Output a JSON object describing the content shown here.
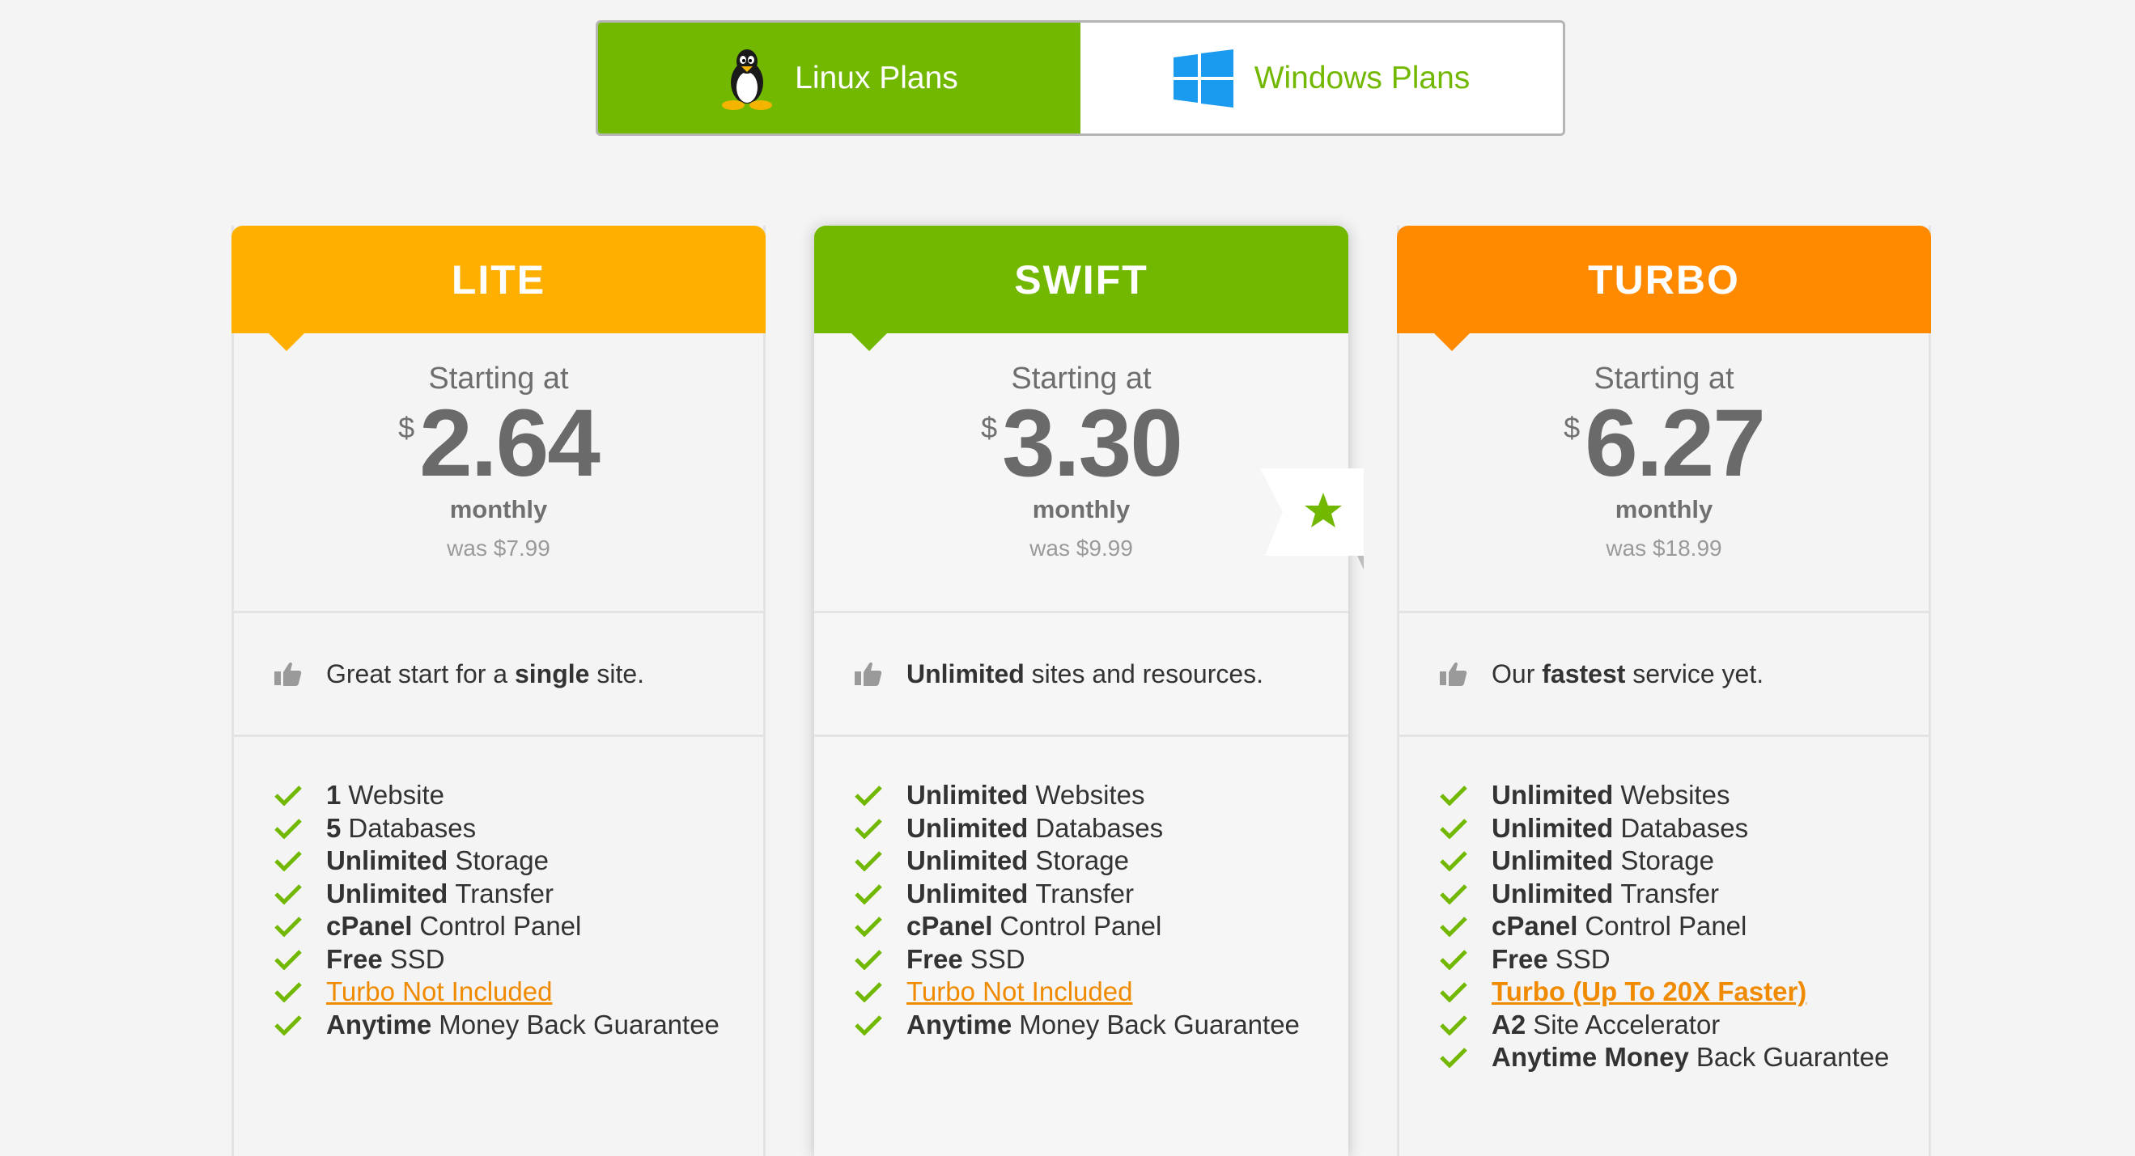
{
  "os_tabs": [
    {
      "label": "Linux Plans",
      "icon": "penguin-icon",
      "active": true
    },
    {
      "label": "Windows Plans",
      "icon": "windows-logo-icon",
      "active": false
    }
  ],
  "colors": {
    "lite": "#ffaf00",
    "swift": "#72b800",
    "turbo": "#ff8a00",
    "link": "#f08a00",
    "check": "#72b800"
  },
  "plans": [
    {
      "name": "LITE",
      "starting": "Starting at",
      "currency": "$",
      "price": "2.64",
      "period": "monthly",
      "was": "was $7.99",
      "tag_pre": "Great start for a",
      "tag_bold": "single",
      "tag_post": "site.",
      "features": [
        {
          "bold": "1",
          "text": "Website"
        },
        {
          "bold": "5",
          "text": "Databases"
        },
        {
          "bold": "Unlimited",
          "text": "Storage"
        },
        {
          "bold": "Unlimited",
          "text": "Transfer"
        },
        {
          "bold": "cPanel",
          "text": "Control Panel"
        },
        {
          "bold": "Free",
          "text": "SSD"
        },
        {
          "link": "Turbo Not Included"
        },
        {
          "bold": "Anytime",
          "text": "Money Back Guarantee"
        }
      ]
    },
    {
      "name": "SWIFT",
      "starting": "Starting at",
      "currency": "$",
      "price": "3.30",
      "period": "monthly",
      "was": "was $9.99",
      "tag_pre": "",
      "tag_bold": "Unlimited",
      "tag_post": "sites and resources.",
      "features": [
        {
          "bold": "Unlimited",
          "text": "Websites"
        },
        {
          "bold": "Unlimited",
          "text": "Databases"
        },
        {
          "bold": "Unlimited",
          "text": "Storage"
        },
        {
          "bold": "Unlimited",
          "text": "Transfer"
        },
        {
          "bold": "cPanel",
          "text": "Control Panel"
        },
        {
          "bold": "Free",
          "text": "SSD"
        },
        {
          "link": "Turbo Not Included"
        },
        {
          "bold": "Anytime",
          "text": "Money Back Guarantee"
        }
      ]
    },
    {
      "name": "TURBO",
      "starting": "Starting at",
      "currency": "$",
      "price": "6.27",
      "period": "monthly",
      "was": "was $18.99",
      "tag_pre": "Our",
      "tag_bold": "fastest",
      "tag_post": "service yet.",
      "features": [
        {
          "bold": "Unlimited",
          "text": "Websites"
        },
        {
          "bold": "Unlimited",
          "text": "Databases"
        },
        {
          "bold": "Unlimited",
          "text": "Storage"
        },
        {
          "bold": "Unlimited",
          "text": "Transfer"
        },
        {
          "bold": "cPanel",
          "text": "Control Panel"
        },
        {
          "bold": "Free",
          "text": "SSD"
        },
        {
          "link": "Turbo (Up To 20X Faster)",
          "link_bold": true
        },
        {
          "bold": "A2",
          "text": "Site Accelerator"
        },
        {
          "bold": "Anytime Money",
          "text": "Back Guarantee"
        }
      ]
    }
  ]
}
